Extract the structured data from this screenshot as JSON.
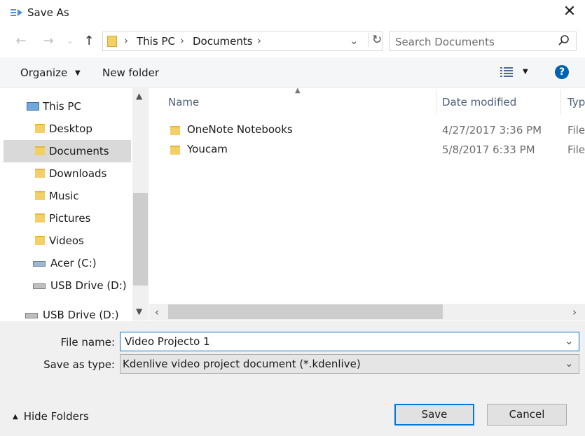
{
  "window": {
    "title": "Save As",
    "close_icon": "close-icon"
  },
  "navigation": {
    "breadcrumb": [
      "This PC",
      "Documents"
    ],
    "search_placeholder": "Search Documents"
  },
  "toolbar": {
    "organize_label": "Organize",
    "new_folder_label": "New folder",
    "help_label": "?"
  },
  "sidebar": {
    "items": [
      {
        "label": "This PC",
        "icon": "computer-icon"
      },
      {
        "label": "Desktop",
        "icon": "folder-icon"
      },
      {
        "label": "Documents",
        "icon": "documents-folder-icon",
        "selected": true
      },
      {
        "label": "Downloads",
        "icon": "downloads-folder-icon"
      },
      {
        "label": "Music",
        "icon": "music-folder-icon"
      },
      {
        "label": "Pictures",
        "icon": "pictures-folder-icon"
      },
      {
        "label": "Videos",
        "icon": "videos-folder-icon"
      },
      {
        "label": "Acer (C:)",
        "icon": "drive-icon"
      },
      {
        "label": "USB Drive (D:)",
        "icon": "usb-drive-icon"
      },
      {
        "label": "USB Drive (D:)",
        "icon": "usb-drive-icon"
      }
    ]
  },
  "file_list": {
    "columns": [
      "Name",
      "Date modified",
      "Typ"
    ],
    "rows": [
      {
        "name": "OneNote Notebooks",
        "date": "4/27/2017 3:36 PM",
        "type": "File"
      },
      {
        "name": "Youcam",
        "date": "5/8/2017 6:33 PM",
        "type": "File"
      }
    ]
  },
  "form": {
    "file_name_label": "File name:",
    "file_name_value": "Video Projecto 1",
    "save_type_label": "Save as type:",
    "save_type_value": "Kdenlive video project document (*.kdenlive)"
  },
  "footer": {
    "hide_folders_label": "Hide Folders",
    "save_label": "Save",
    "cancel_label": "Cancel"
  },
  "colors": {
    "accent": "#0078d7",
    "help": "#0063b1",
    "folder": "#f3cf68",
    "selected": "#d9d9d9"
  }
}
